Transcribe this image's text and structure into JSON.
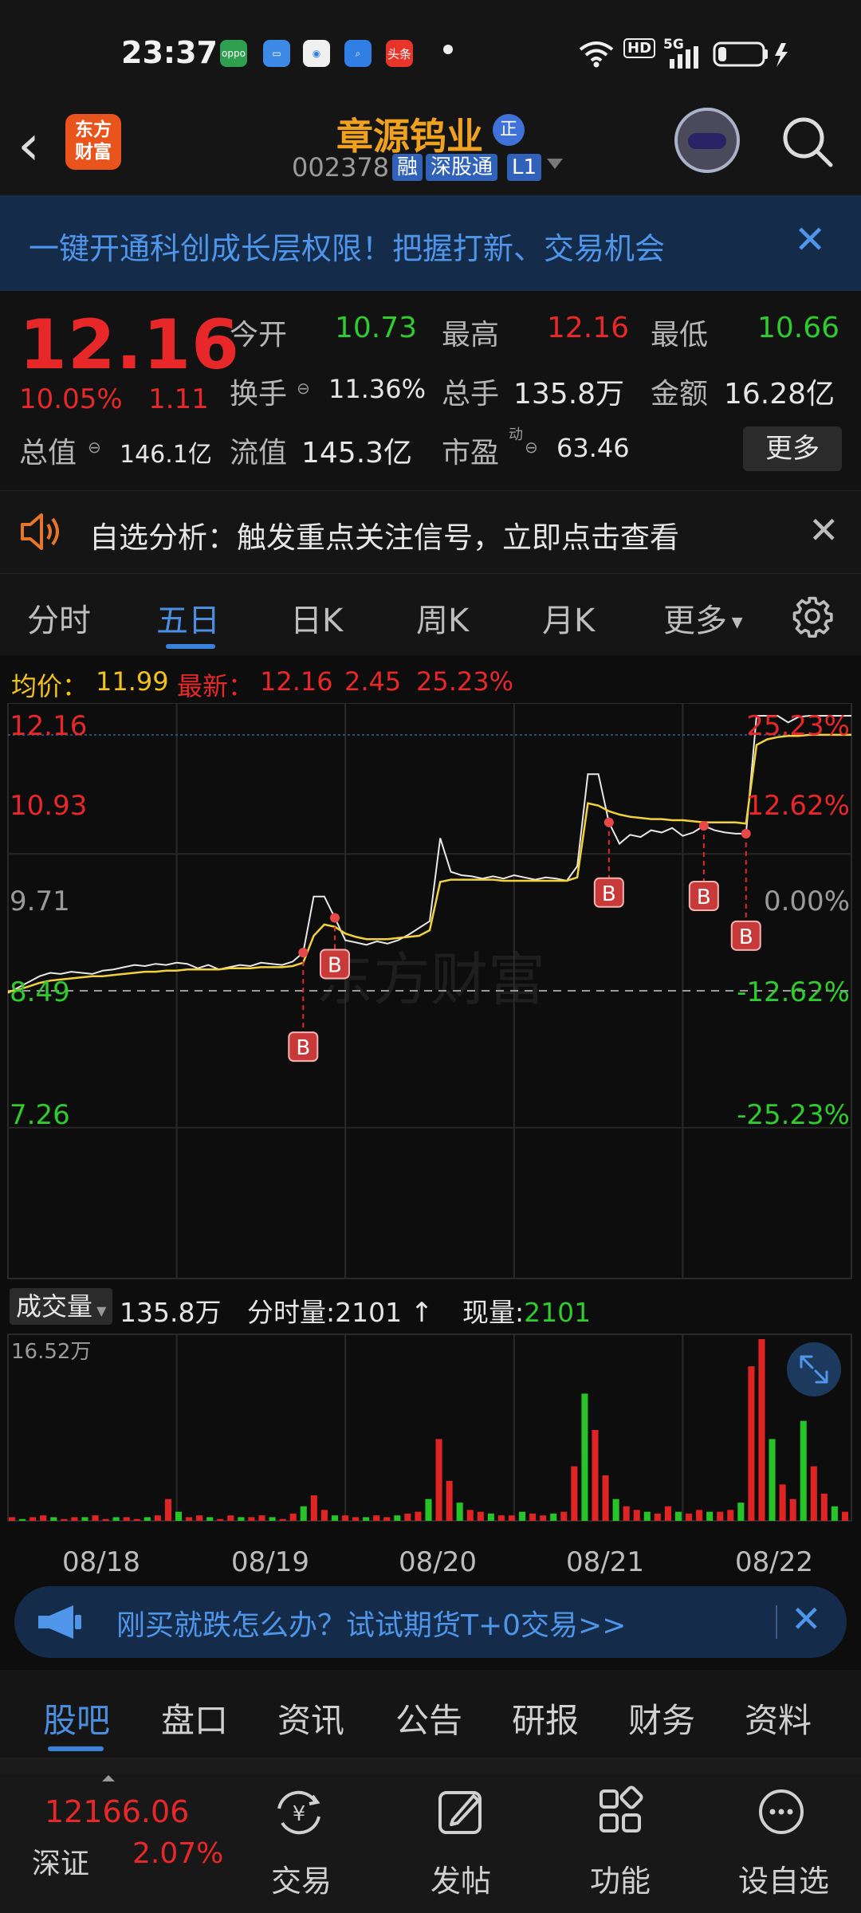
{
  "status_bar": {
    "time": "23:37",
    "apps": [
      {
        "name": "oppo-icon",
        "label": "oppo",
        "color": "#2e9e4f"
      },
      {
        "name": "files-icon",
        "label": "",
        "color": "#3d8ae6"
      },
      {
        "name": "browser-icon",
        "label": "",
        "color": "#f0f0f0"
      },
      {
        "name": "search-app-icon",
        "label": "",
        "color": "#2f7fe5"
      },
      {
        "name": "toutiao-icon",
        "label": "头条",
        "color": "#e8352a"
      }
    ],
    "hd": "HD",
    "network": "5G"
  },
  "header": {
    "logo_text_1": "东方",
    "logo_text_2": "财富",
    "stock_name": "章源钨业",
    "zheng_badge": "正",
    "stock_code": "002378",
    "tags": [
      "融",
      "深股通",
      "L1"
    ]
  },
  "promo_banner": {
    "text": "一键开通科创成长层权限！把握打新、交易机会"
  },
  "quote": {
    "price": "12.16",
    "change_pct": "10.05%",
    "change": "1.11",
    "open_label": "今开",
    "open": "10.73",
    "high_label": "最高",
    "high": "12.16",
    "low_label": "最低",
    "low": "10.66",
    "turnover_label": "换手",
    "turnover": "11.36%",
    "volume_label": "总手",
    "volume": "135.8万",
    "amount_label": "金额",
    "amount": "16.28亿",
    "mktcap_label": "总值",
    "mktcap": "146.1亿",
    "float_label": "流值",
    "float": "145.3亿",
    "pe_label": "市盈",
    "pe_sup": "动",
    "pe": "63.46",
    "more_button": "更多"
  },
  "analysis_banner": {
    "text": "自选分析：触发重点关注信号，立即点击查看"
  },
  "tabs": [
    "分时",
    "五日",
    "日K",
    "周K",
    "月K",
    "更多"
  ],
  "avg_line": {
    "avg_label": "均价：",
    "avg": "11.99",
    "latest_label": "最新：",
    "latest": "12.16",
    "change": "2.45",
    "change_pct": "25.23%"
  },
  "chart_data": {
    "type": "line",
    "x": [
      "08/18",
      "08/19",
      "08/20",
      "08/21",
      "08/22"
    ],
    "y_left_ticks": [
      "12.16",
      "10.93",
      "9.71",
      "8.49",
      "7.26"
    ],
    "y_right_ticks": [
      "25.23%",
      "12.62%",
      "0.00%",
      "-12.62%",
      "-25.23%"
    ],
    "ylim": [
      7.26,
      12.16
    ],
    "prev_close": 9.71,
    "series": [
      {
        "name": "价格",
        "values": [
          9.69,
          9.74,
          9.79,
          9.84,
          9.87,
          9.86,
          9.88,
          9.87,
          9.86,
          9.89,
          9.9,
          9.92,
          9.94,
          9.93,
          9.95,
          9.94,
          9.96,
          9.95,
          9.91,
          9.94,
          9.9,
          9.92,
          9.94,
          9.93,
          9.96,
          9.95,
          9.94,
          9.97,
          10.05,
          10.55,
          10.55,
          10.36,
          10.16,
          10.14,
          10.12,
          10.15,
          10.13,
          10.16,
          10.21,
          10.27,
          10.33,
          11.07,
          10.77,
          10.74,
          10.73,
          10.71,
          10.73,
          10.71,
          10.74,
          10.72,
          10.7,
          10.72,
          10.71,
          10.69,
          10.82,
          11.64,
          11.64,
          11.21,
          11.02,
          11.1,
          11.08,
          11.14,
          11.12,
          11.16,
          11.09,
          11.12,
          11.18,
          11.14,
          11.12,
          11.11,
          11.11,
          12.16,
          12.16,
          12.16,
          12.1,
          12.15,
          12.16,
          12.16,
          12.16,
          12.16,
          12.16
        ]
      },
      {
        "name": "均价",
        "values": [
          9.7,
          9.72,
          9.75,
          9.78,
          9.8,
          9.81,
          9.82,
          9.83,
          9.84,
          9.84,
          9.85,
          9.86,
          9.87,
          9.88,
          9.88,
          9.89,
          9.89,
          9.9,
          9.9,
          9.9,
          9.9,
          9.91,
          9.91,
          9.91,
          9.92,
          9.92,
          9.92,
          9.93,
          9.96,
          10.2,
          10.3,
          10.28,
          10.22,
          10.19,
          10.17,
          10.17,
          10.17,
          10.18,
          10.19,
          10.2,
          10.25,
          10.68,
          10.7,
          10.7,
          10.7,
          10.7,
          10.7,
          10.69,
          10.69,
          10.69,
          10.69,
          10.69,
          10.69,
          10.69,
          10.72,
          11.38,
          11.36,
          11.31,
          11.28,
          11.26,
          11.25,
          11.24,
          11.24,
          11.23,
          11.23,
          11.22,
          11.21,
          11.21,
          11.21,
          11.21,
          11.2,
          11.9,
          11.95,
          11.97,
          11.98,
          11.98,
          11.99,
          11.99,
          11.99,
          11.99,
          11.99
        ]
      }
    ],
    "markers": [
      "B",
      "B",
      "B",
      "B",
      "B"
    ],
    "watermark": "东方财富"
  },
  "volume_bar": {
    "selector": "成交量",
    "total": "135.8万",
    "minute_label": "分时量:",
    "minute": "2101",
    "current_label": "现量:",
    "current": "2101"
  },
  "volume_chart": {
    "max_label": "16.52万",
    "values": [
      0.02,
      0.01,
      0.02,
      0.03,
      0.02,
      0.01,
      0.02,
      0.02,
      0.03,
      0.01,
      0.02,
      0.02,
      0.01,
      0.02,
      0.03,
      0.12,
      0.05,
      0.02,
      0.03,
      0.02,
      0.01,
      0.03,
      0.02,
      0.02,
      0.03,
      0.02,
      0.01,
      0.04,
      0.08,
      0.14,
      0.06,
      0.03,
      0.03,
      0.02,
      0.02,
      0.03,
      0.02,
      0.03,
      0.04,
      0.05,
      0.12,
      0.45,
      0.22,
      0.1,
      0.06,
      0.05,
      0.04,
      0.03,
      0.03,
      0.05,
      0.04,
      0.03,
      0.04,
      0.05,
      0.3,
      0.7,
      0.5,
      0.25,
      0.12,
      0.08,
      0.06,
      0.05,
      0.04,
      0.08,
      0.05,
      0.04,
      0.06,
      0.05,
      0.05,
      0.06,
      0.1,
      0.85,
      1.0,
      0.45,
      0.2,
      0.12,
      0.55,
      0.3,
      0.15,
      0.08,
      0.05
    ],
    "colors": [
      "#e02424",
      "#27c427"
    ]
  },
  "futures_banner": {
    "text": "刚买就跌怎么办？试试期货T+0交易>>"
  },
  "bottom_tabs": [
    "股吧",
    "盘口",
    "资讯",
    "公告",
    "研报",
    "财务",
    "资料"
  ],
  "bottom_bar": {
    "index_value": "12166.06",
    "index_name": "深证",
    "index_pct": "2.07%",
    "items": [
      "交易",
      "发帖",
      "功能",
      "设自选"
    ]
  }
}
